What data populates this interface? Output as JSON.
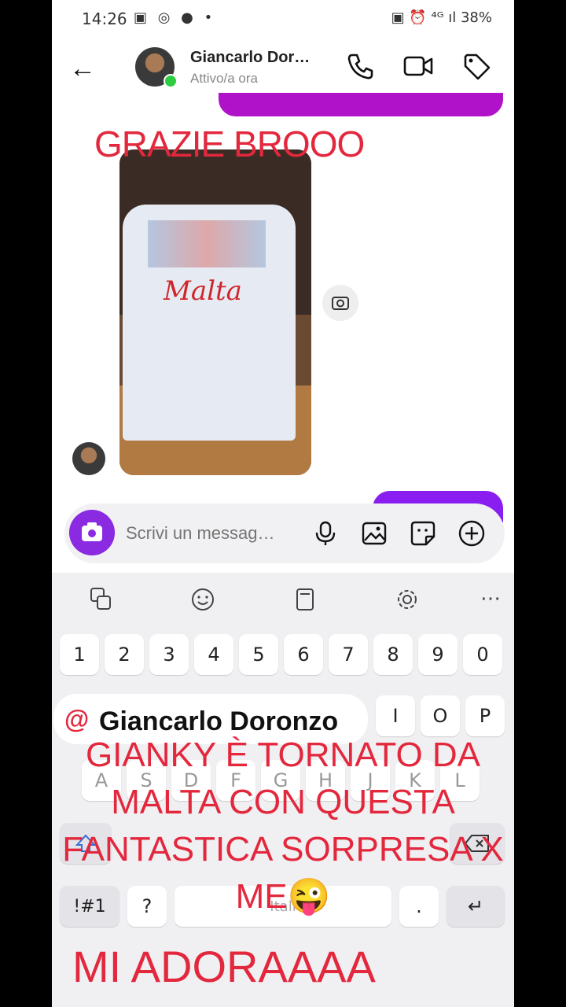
{
  "status_bar": {
    "time": "14:26",
    "battery": "38%",
    "left_icons": "▣ ◎ ● •",
    "right_icons": "▣ ⏰ ⁴ᴳ ıl"
  },
  "chat_header": {
    "contact_name": "Giancarlo Dor…",
    "status": "Attivo/a ora"
  },
  "photo": {
    "print_text": "Malta"
  },
  "composer": {
    "placeholder": "Scrivi un messag…"
  },
  "keyboard": {
    "number_row": [
      "1",
      "2",
      "3",
      "4",
      "5",
      "6",
      "7",
      "8",
      "9",
      "0"
    ],
    "row_q_visible": [
      "I",
      "O",
      "P"
    ],
    "row_a": [
      "A",
      "S",
      "D",
      "F",
      "G",
      "H",
      "J",
      "K",
      "L"
    ],
    "bottom_left": "!#1",
    "question": "?",
    "space": "Itali",
    "period": ".",
    "enter": "↵",
    "more": "⋯"
  },
  "overlays": {
    "top_text": "GRAZIE BROOO",
    "tag_at": "@",
    "tag_name": "Giancarlo Doronzo",
    "main_line1": "GIANKY È TORNATO DA",
    "main_line2": "MALTA CON QUESTA",
    "main_line3": "FANTASTICA SORPRESA X",
    "main_line4": "ME😜",
    "bottom_text": "MI ADORAAAA"
  },
  "colors": {
    "sent_bubble": "#b012c9",
    "sent_bubble_2": "#8a1ef0",
    "overlay_red": "#e3283e",
    "camera_button": "#8a2be2"
  }
}
